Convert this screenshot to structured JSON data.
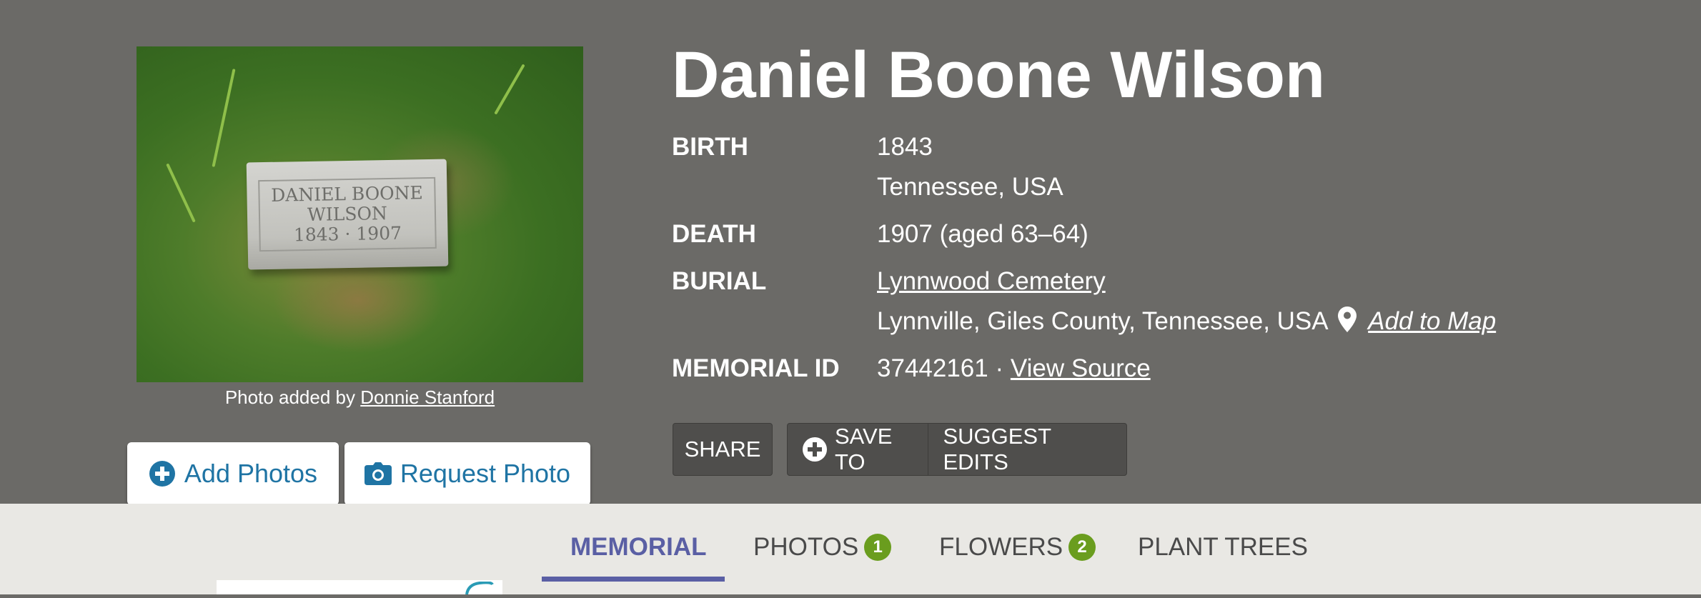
{
  "photo": {
    "stone_lines": [
      "DANIEL BOONE",
      "WILSON",
      "1843 · 1907"
    ],
    "credit_prefix": "Photo added by",
    "credit_name": "Donnie Stanford"
  },
  "actions": {
    "add_photos": "Add Photos",
    "request_photo": "Request Photo"
  },
  "memorial": {
    "name": "Daniel Boone Wilson",
    "birth_label": "BIRTH",
    "birth_date": "1843",
    "birth_place": "Tennessee, USA",
    "death_label": "DEATH",
    "death_date": "1907 (aged 63–64)",
    "burial_label": "BURIAL",
    "cemetery": "Lynnwood Cemetery",
    "burial_place": "Lynnville, Giles County, Tennessee, USA",
    "add_to_map": "Add to Map",
    "id_label": "MEMORIAL ID",
    "id_value": "37442161",
    "id_separator": "·",
    "view_source": "View Source"
  },
  "toolbar": {
    "share": "SHARE",
    "save_to": "SAVE TO",
    "suggest_edits": "SUGGEST EDITS"
  },
  "tabs": [
    {
      "label": "MEMORIAL",
      "badge": null,
      "active": true
    },
    {
      "label": "PHOTOS",
      "badge": "1",
      "active": false
    },
    {
      "label": "FLOWERS",
      "badge": "2",
      "active": false
    },
    {
      "label": "PLANT TREES",
      "badge": null,
      "active": false
    }
  ],
  "colors": {
    "hero_bg": "#6b6a67",
    "link_blue": "#1f74a4",
    "tab_active": "#5a5fa4",
    "badge_green": "#6a9d1e"
  }
}
